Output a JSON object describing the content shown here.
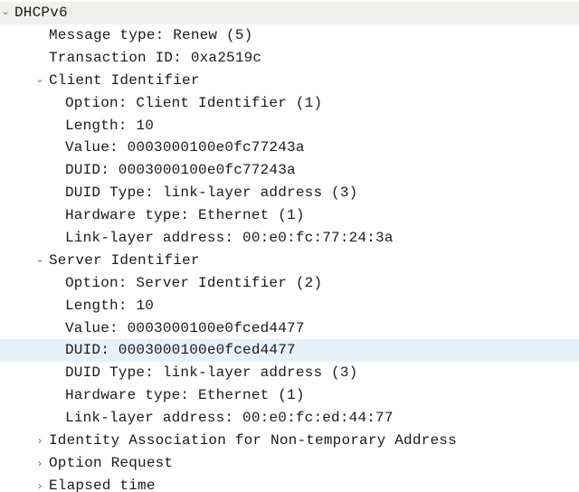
{
  "root": {
    "title": "DHCPv6",
    "fields": [
      {
        "text": "Message type: Renew (5)"
      },
      {
        "text": "Transaction ID: 0xa2519c"
      }
    ],
    "sections": [
      {
        "title": "Client Identifier",
        "expanded": true,
        "fields": [
          {
            "text": "Option: Client Identifier (1)"
          },
          {
            "text": "Length: 10"
          },
          {
            "text": "Value: 0003000100e0fc77243a"
          },
          {
            "text": "DUID: 0003000100e0fc77243a"
          },
          {
            "text": "DUID Type: link-layer address (3)"
          },
          {
            "text": "Hardware type: Ethernet (1)"
          },
          {
            "text": "Link-layer address: 00:e0:fc:77:24:3a"
          }
        ]
      },
      {
        "title": "Server Identifier",
        "expanded": true,
        "fields": [
          {
            "text": "Option: Server Identifier (2)"
          },
          {
            "text": "Length: 10"
          },
          {
            "text": "Value: 0003000100e0fced4477"
          },
          {
            "text": "DUID: 0003000100e0fced4477",
            "highlighted": true
          },
          {
            "text": "DUID Type: link-layer address (3)"
          },
          {
            "text": "Hardware type: Ethernet (1)"
          },
          {
            "text": "Link-layer address: 00:e0:fc:ed:44:77"
          }
        ]
      },
      {
        "title": "Identity Association for Non-temporary Address",
        "expanded": false,
        "fields": []
      },
      {
        "title": "Option Request",
        "expanded": false,
        "fields": []
      },
      {
        "title": "Elapsed time",
        "expanded": false,
        "fields": []
      }
    ]
  }
}
